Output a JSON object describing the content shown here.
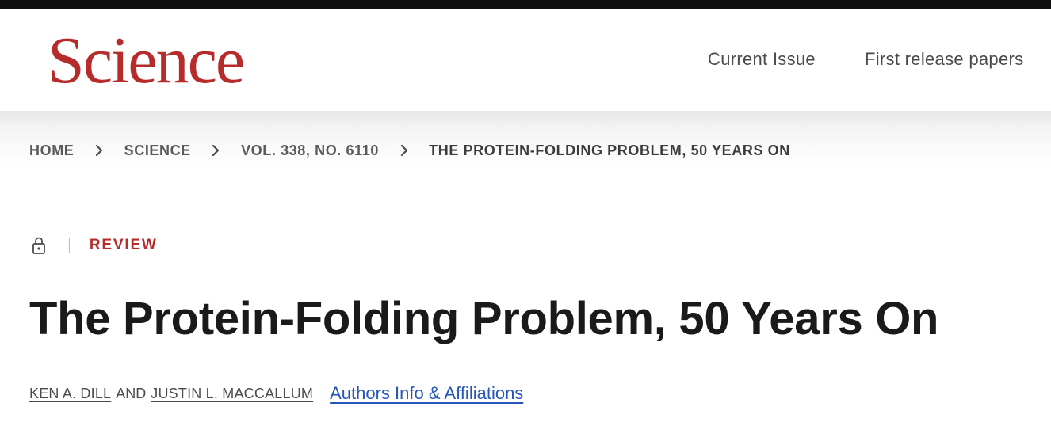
{
  "header": {
    "logo_text": "Science",
    "nav": [
      {
        "label": "Current Issue"
      },
      {
        "label": "First release papers"
      }
    ]
  },
  "breadcrumb": {
    "items": [
      "HOME",
      "SCIENCE",
      "VOL. 338, NO. 6110",
      "THE PROTEIN-FOLDING PROBLEM, 50 YEARS ON"
    ]
  },
  "article": {
    "access_icon": "lock-icon",
    "type": "REVIEW",
    "title": "The Protein-Folding Problem, 50 Years On",
    "authors": [
      "KEN A. DILL",
      "JUSTIN L. MACCALLUM"
    ],
    "conjunction": "AND",
    "affiliations_link": "Authors Info & Affiliations"
  },
  "colors": {
    "brand": "#b62c2b",
    "link": "#2556b8",
    "text": "#1a1a1a"
  }
}
